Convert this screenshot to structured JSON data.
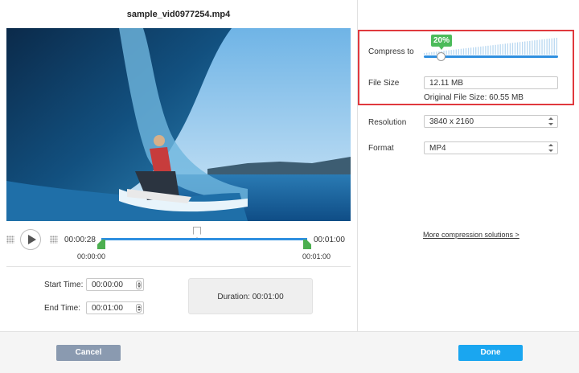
{
  "file_name": "sample_vid0977254.mp4",
  "player": {
    "current_time": "00:00:28",
    "end_time_label": "00:01:00",
    "trim_start_label": "00:00:00",
    "trim_end_label": "00:01:00",
    "playhead_fraction": 0.47
  },
  "trim": {
    "start_label": "Start Time:",
    "start_value": "00:00:00",
    "end_label": "End Time:",
    "end_value": "00:01:00",
    "duration_label": "Duration:",
    "duration_value": "00:01:00"
  },
  "compress": {
    "label": "Compress to",
    "percent": "20%",
    "percent_value": 0.2,
    "file_size_label": "File Size",
    "file_size_value": "12.11  MB",
    "original_size": "Original File Size: 60.55 MB"
  },
  "resolution": {
    "label": "Resolution",
    "value": "3840 x 2160"
  },
  "format": {
    "label": "Format",
    "value": "MP4"
  },
  "more_link": "More compression solutions >",
  "buttons": {
    "cancel": "Cancel",
    "done": "Done"
  },
  "colors": {
    "accent": "#2f8fe0",
    "green": "#4cbb5a",
    "highlight": "#e0393e",
    "done": "#1aa6f0",
    "cancel": "#8a9ab0"
  }
}
